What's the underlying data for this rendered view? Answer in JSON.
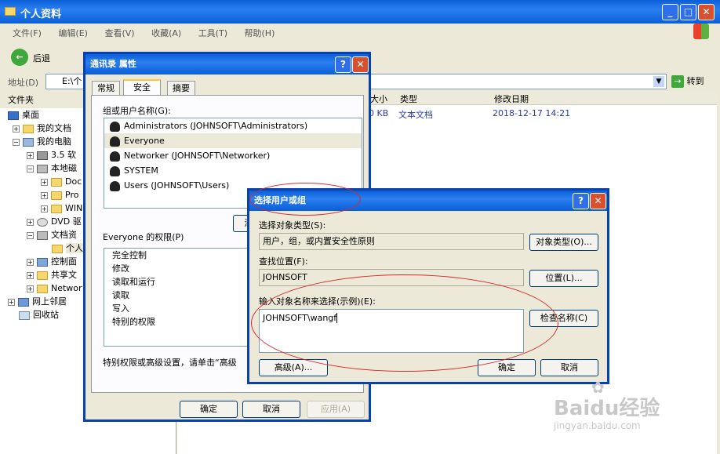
{
  "window": {
    "title": "个人资料",
    "winlogo": "windows-flag"
  },
  "menu": [
    "文件(F)",
    "编辑(E)",
    "查看(V)",
    "收藏(A)",
    "工具(T)",
    "帮助(H)"
  ],
  "toolbar": {
    "back": "后退"
  },
  "address": {
    "label": "地址(D)",
    "value": "E:\\个",
    "go": "转到"
  },
  "sidebar": {
    "title": "文件夹",
    "items": [
      "桌面",
      "我的文档",
      "我的电脑",
      "3.5 软",
      "本地磁",
      "Doc",
      "Pro",
      "WIN",
      "DVD 驱",
      "文档资",
      "个人",
      "控制面",
      "共享文",
      "Networ",
      "网上邻居",
      "回收站"
    ]
  },
  "filelist": {
    "columns": [
      "大小",
      "类型",
      "修改日期"
    ],
    "row": {
      "size": "0 KB",
      "type": "文本文档",
      "date": "2018-12-17 14:21"
    }
  },
  "props": {
    "title": "通讯录 属性",
    "tabs": [
      "常规",
      "安全",
      "摘要"
    ],
    "group_label": "组或用户名称(G):",
    "users": [
      "Administrators (JOHNSOFT\\Administrators)",
      "Everyone",
      "Networker (JOHNSOFT\\Networker)",
      "SYSTEM",
      "Users (JOHNSOFT\\Users)"
    ],
    "add_btn": "添",
    "perm_label": "Everyone 的权限(P)",
    "perms": [
      "完全控制",
      "修改",
      "读取和运行",
      "读取",
      "写入",
      "特别的权限"
    ],
    "special_text": "特别权限或高级设置，请单击“高级",
    "ok": "确定",
    "cancel": "取消",
    "apply": "应用(A)"
  },
  "select": {
    "title": "选择用户或组",
    "obj_type_label": "选择对象类型(S):",
    "obj_type_value": "用户，组，或内置安全性原则",
    "obj_type_btn": "对象类型(O)...",
    "location_label": "查找位置(F):",
    "location_value": "JOHNSOFT",
    "location_btn": "位置(L)...",
    "names_label": "输入对象名称来选择(示例)(E):",
    "names_value": "JOHNSOFT\\wangf",
    "check_btn": "检查名称(C)",
    "advanced_btn": "高级(A)...",
    "ok": "确定",
    "cancel": "取消"
  },
  "watermark": {
    "brand": "Baidu经验",
    "url": "jingyan.baidu.com"
  },
  "colors": {
    "title_blue": "#0A5FD8",
    "annotation_red": "#D62B2B"
  }
}
